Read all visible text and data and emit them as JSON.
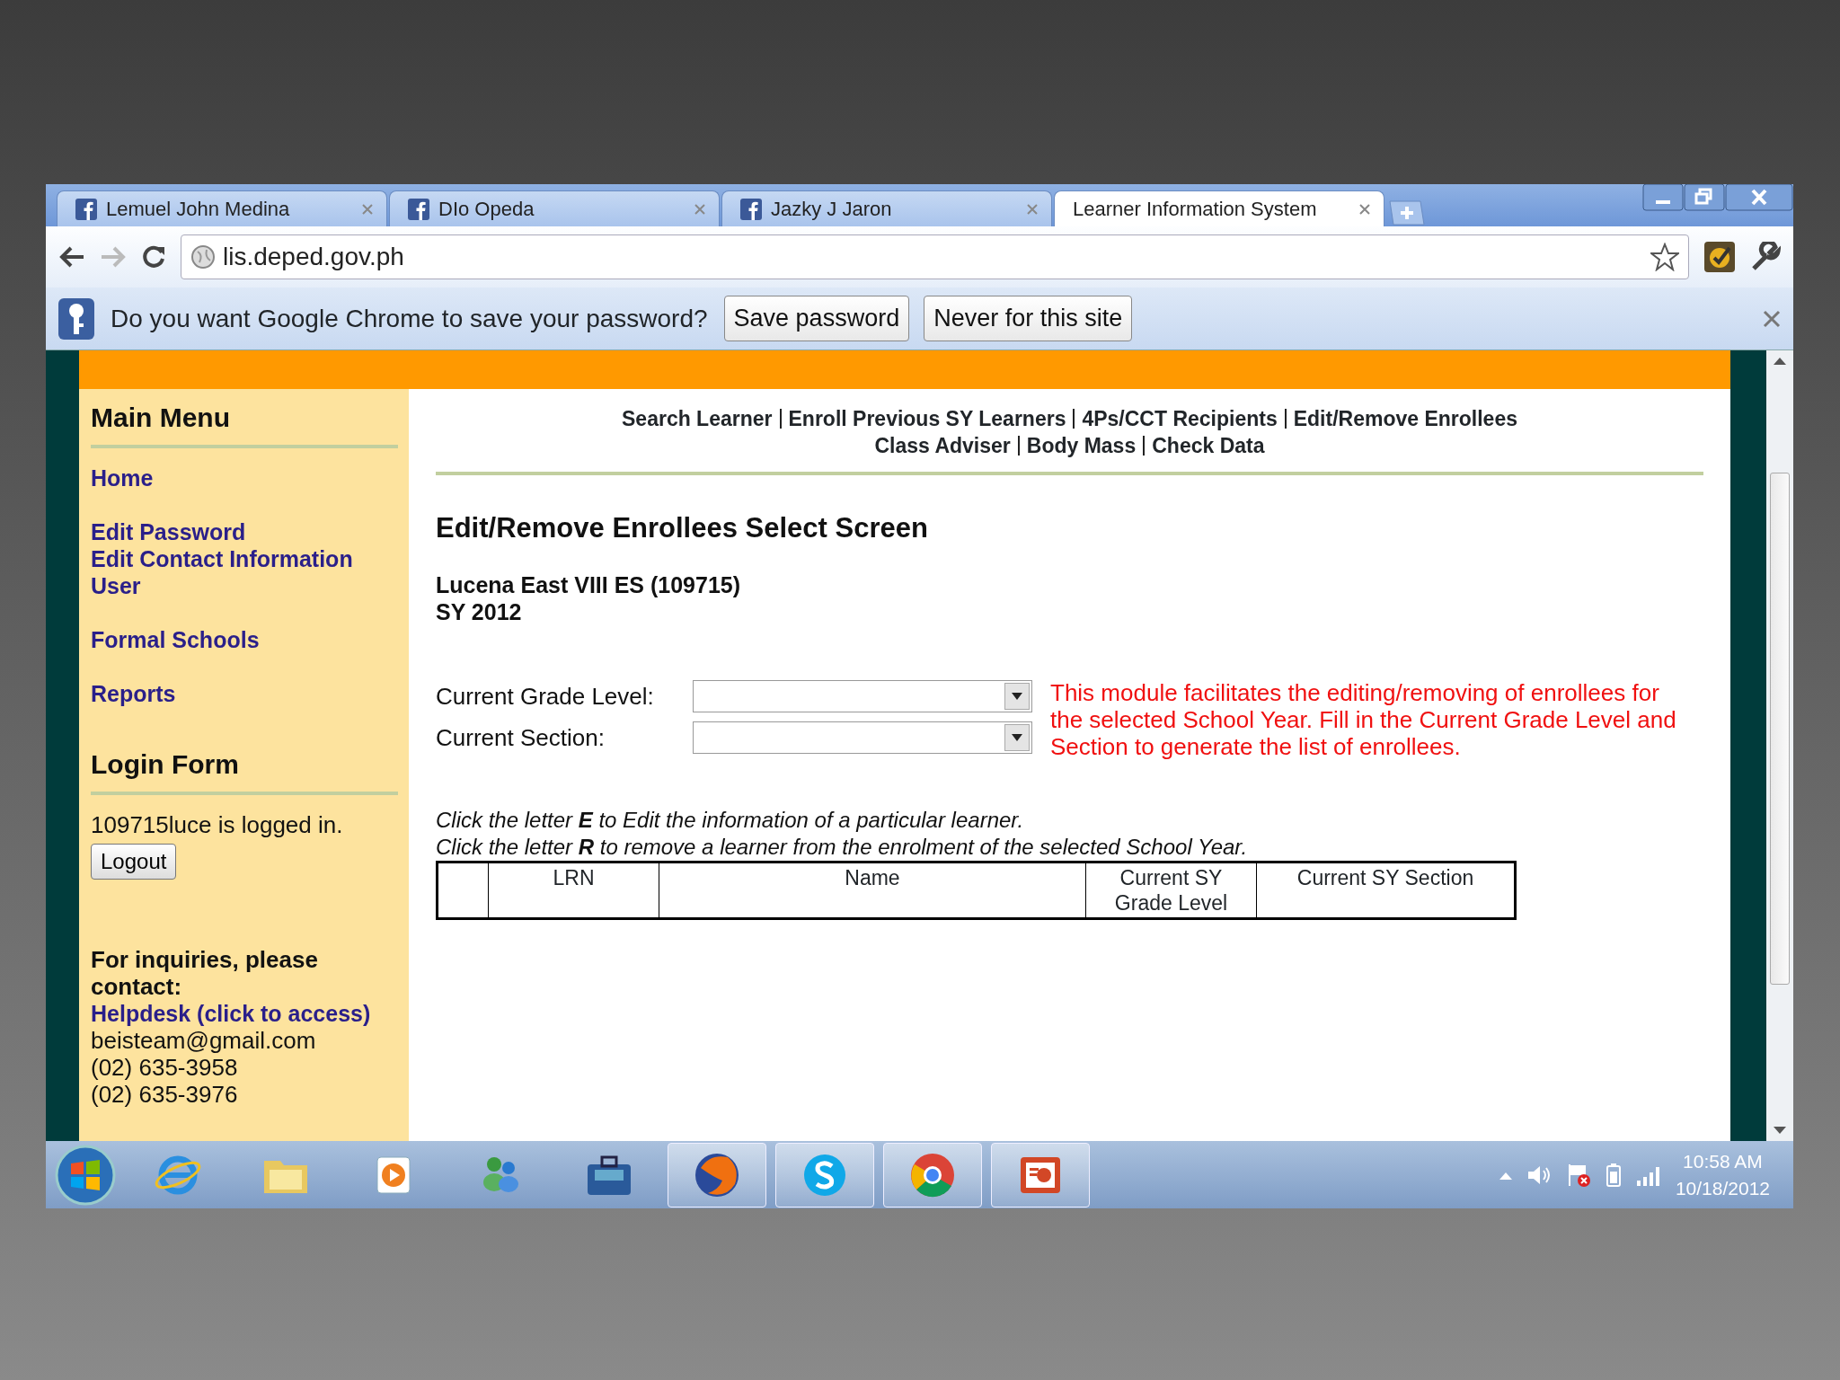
{
  "browser": {
    "tabs": [
      {
        "label": "Lemuel John Medina",
        "selected": false,
        "favicon": true
      },
      {
        "label": "DIo Opeda",
        "selected": false,
        "favicon": true
      },
      {
        "label": "Jazky J Jaron",
        "selected": false,
        "favicon": true
      },
      {
        "label": "Learner Information System",
        "selected": true,
        "favicon": false
      }
    ],
    "address": "lis.deped.gov.ph",
    "infobar": {
      "message": "Do you want Google Chrome to save your password?",
      "buttons": [
        "Save password",
        "Never for this site"
      ]
    }
  },
  "sidebar": {
    "menu_title": "Main Menu",
    "menu_groups": [
      [
        "Home"
      ],
      [
        "Edit Password",
        "Edit Contact Information",
        "User"
      ],
      [
        "Formal Schools"
      ],
      [
        "Reports"
      ]
    ],
    "login_title": "Login Form",
    "login_status": "109715luce is logged in.",
    "logout_button": "Logout",
    "contact_heading": "For inquiries, please contact:",
    "contact_link": "Helpdesk (click to access)",
    "contact_lines": [
      "beisteam@gmail.com",
      "(02) 635-3958",
      "(02) 635-3976"
    ]
  },
  "content": {
    "nav_rows": [
      [
        "Search Learner",
        "Enroll Previous SY Learners",
        "4Ps/CCT Recipients",
        "Edit/Remove Enrollees"
      ],
      [
        "Class Adviser",
        "Body Mass",
        "Check Data"
      ]
    ],
    "title": "Edit/Remove Enrollees Select Screen",
    "school": "Lucena East VIII ES (109715)",
    "school_year": "SY 2012",
    "fields": [
      {
        "label": "Current Grade Level:"
      },
      {
        "label": "Current Section:"
      }
    ],
    "note": "This module facilitates the editing/removing of enrollees for the selected School Year. Fill in the Current Grade Level and Section to generate the list of enrollees.",
    "instructions": [
      "Click the letter **E** to Edit the information of a particular learner.",
      "Click the letter **R** to remove a learner from the enrolment of the selected School Year."
    ],
    "table": {
      "columns": [
        "LRN",
        "Name",
        "Current SY Grade Level",
        "Current SY Section"
      ]
    }
  },
  "taskbar": {
    "apps": [
      {
        "kind": "browser-e",
        "open": false
      },
      {
        "kind": "folder",
        "open": false
      },
      {
        "kind": "media",
        "open": false
      },
      {
        "kind": "people",
        "open": false
      },
      {
        "kind": "briefcase",
        "open": false
      },
      {
        "kind": "fox",
        "open": true
      },
      {
        "kind": "chat",
        "open": true
      },
      {
        "kind": "circle",
        "open": true
      },
      {
        "kind": "slides",
        "open": true
      }
    ],
    "time": "10:58 AM",
    "date": "10/18/2012"
  }
}
